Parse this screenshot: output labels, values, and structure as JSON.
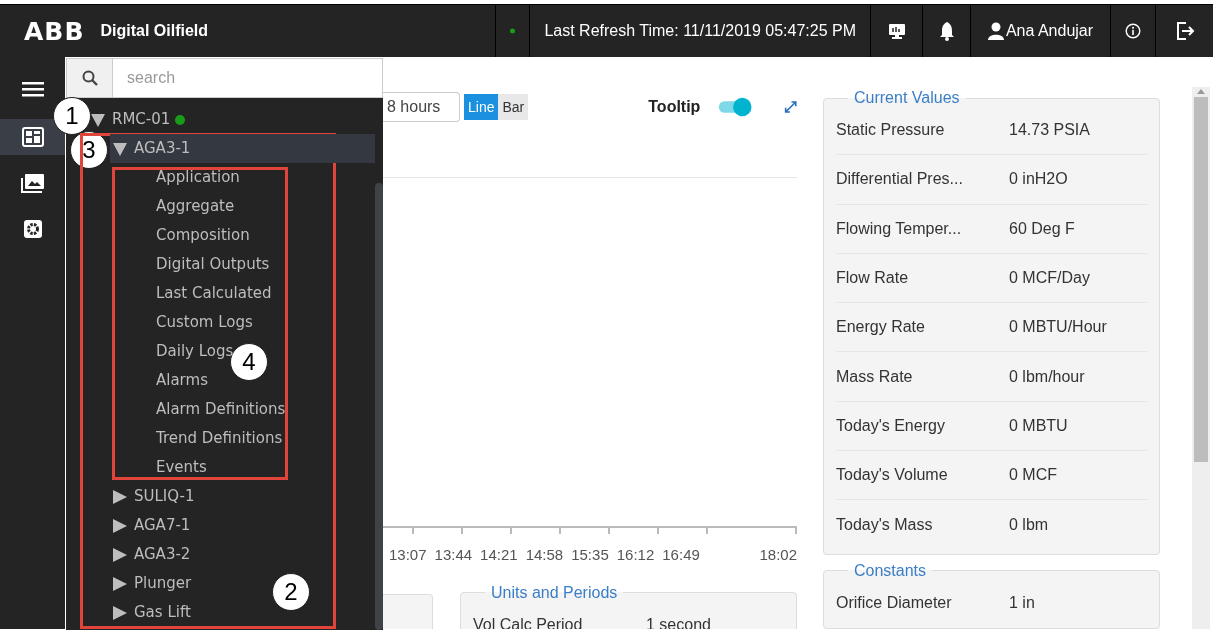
{
  "header": {
    "logo": "ABB",
    "app_title": "Digital Oilfield",
    "connected": true,
    "refresh_text": "Last Refresh Time: 11/11/2019 05:47:25 PM",
    "user": "Ana Andujar"
  },
  "search": {
    "placeholder": "search"
  },
  "tree": [
    {
      "label": "RMC-01",
      "online": true,
      "expanded": true,
      "selected": false,
      "children": [
        {
          "label": "AGA3-1",
          "expanded": true,
          "selected": true,
          "children": [
            {
              "label": "Application",
              "selected": false
            },
            {
              "label": "Aggregate",
              "selected": false
            },
            {
              "label": "Composition",
              "selected": false
            },
            {
              "label": "Digital Outputs",
              "selected": false
            },
            {
              "label": "Last Calculated",
              "selected": false
            },
            {
              "label": "Custom Logs",
              "selected": false
            },
            {
              "label": "Daily Logs",
              "selected": false
            },
            {
              "label": "Alarms",
              "selected": false
            },
            {
              "label": "Alarm Definitions",
              "selected": false
            },
            {
              "label": "Trend Definitions",
              "selected": false
            },
            {
              "label": "Events",
              "selected": false
            }
          ]
        },
        {
          "label": "SULIQ-1",
          "expanded": false,
          "selected": false
        },
        {
          "label": "AGA7-1",
          "expanded": false,
          "selected": false
        },
        {
          "label": "AGA3-2",
          "expanded": false,
          "selected": false
        },
        {
          "label": "Plunger",
          "expanded": false,
          "selected": false
        },
        {
          "label": "Gas Lift",
          "expanded": false,
          "selected": false
        }
      ]
    }
  ],
  "chart_controls": {
    "range": "8 hours",
    "chart_types": [
      {
        "label": "Line",
        "selected": true
      },
      {
        "label": "Bar",
        "selected": false
      }
    ],
    "tooltip": {
      "label": "Tooltip",
      "on": true
    }
  },
  "x_axis_labels": [
    "13:07",
    "13:44",
    "14:21",
    "14:58",
    "15:35",
    "16:12",
    "16:49",
    "18:02"
  ],
  "units_and_periods": {
    "title": "Units and Periods",
    "rows": [
      {
        "label": "Vol Calc Period",
        "value": "1 second"
      }
    ]
  },
  "current_values": {
    "title": "Current Values",
    "rows": [
      {
        "label": "Static Pressure",
        "value": "14.73 PSIA"
      },
      {
        "label": "Differential Pres...",
        "value": "0 inH2O"
      },
      {
        "label": "Flowing Temper...",
        "value": "60 Deg F"
      },
      {
        "label": "Flow Rate",
        "value": "0 MCF/Day"
      },
      {
        "label": "Energy Rate",
        "value": "0 MBTU/Hour"
      },
      {
        "label": "Mass Rate",
        "value": "0 lbm/hour"
      },
      {
        "label": "Today's Energy",
        "value": "0 MBTU"
      },
      {
        "label": "Today's Volume",
        "value": "0 MCF"
      },
      {
        "label": "Today's Mass",
        "value": "0 lbm"
      }
    ]
  },
  "constants": {
    "title": "Constants",
    "rows": [
      {
        "label": "Orifice Diameter",
        "value": "1 in"
      }
    ]
  },
  "callouts": [
    {
      "label": "1"
    },
    {
      "label": "3"
    },
    {
      "label": "4"
    },
    {
      "label": "2"
    }
  ]
}
